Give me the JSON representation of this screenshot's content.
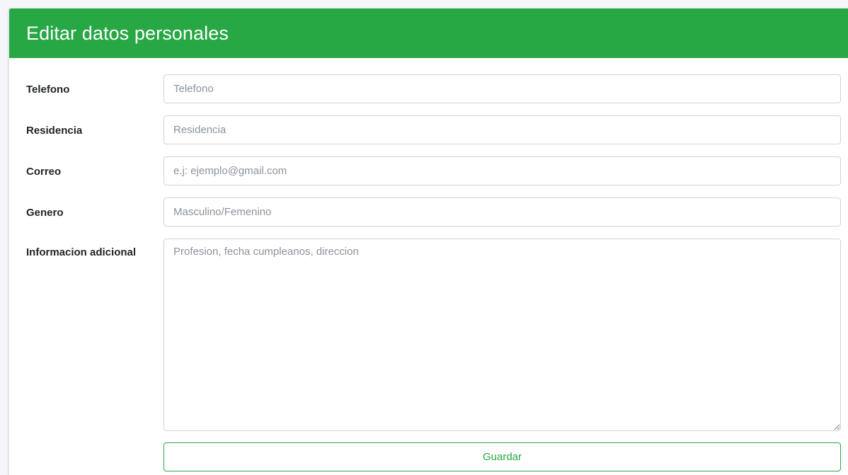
{
  "header": {
    "title": "Editar datos personales",
    "color": "#28a745"
  },
  "form": {
    "fields": [
      {
        "label": "Telefono",
        "placeholder": "Telefono",
        "value": ""
      },
      {
        "label": "Residencia",
        "placeholder": "Residencia",
        "value": ""
      },
      {
        "label": "Correo",
        "placeholder": "e.j: ejemplo@gmail.com",
        "value": ""
      },
      {
        "label": "Genero",
        "placeholder": "Masculino/Femenino",
        "value": ""
      }
    ],
    "additional": {
      "label": "Informacion adicional",
      "placeholder": "Profesion, fecha cumpleanos, direccion",
      "value": ""
    },
    "submit_label": "Guardar"
  }
}
